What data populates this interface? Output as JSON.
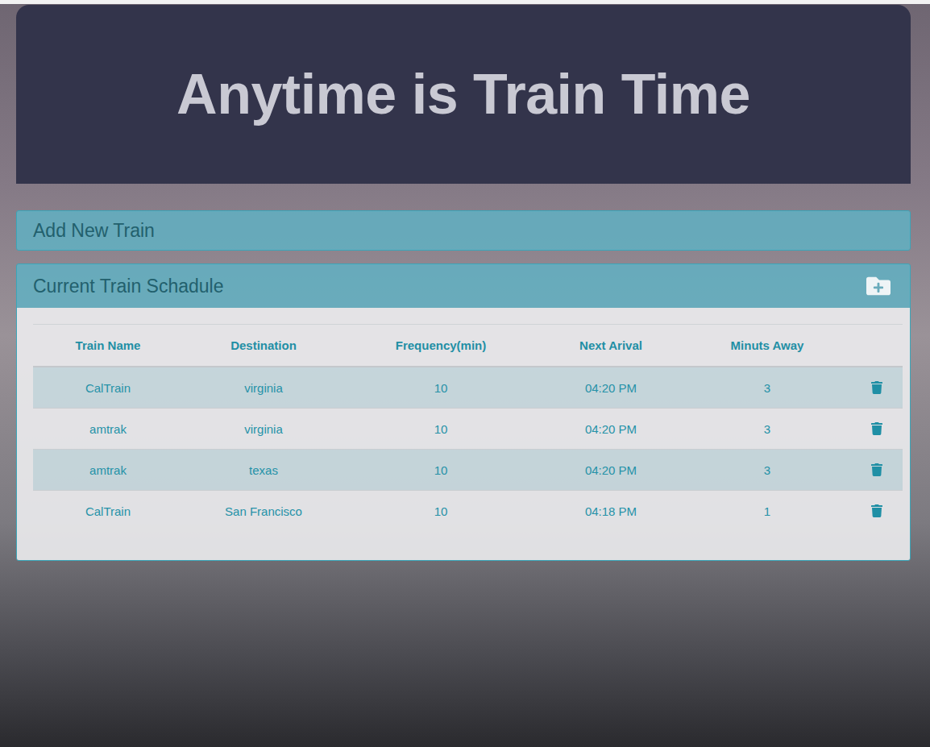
{
  "header": {
    "title": "Anytime is Train Time"
  },
  "add_panel": {
    "title": "Add New Train"
  },
  "schedule_panel": {
    "title": "Current Train Schadule"
  },
  "table": {
    "columns": [
      "Train Name",
      "Destination",
      "Frequency(min)",
      "Next Arival",
      "Minuts Away"
    ],
    "rows": [
      {
        "name": "CalTrain",
        "destination": "virginia",
        "frequency": "10",
        "next_arrival": "04:20 PM",
        "minutes_away": "3"
      },
      {
        "name": "amtrak",
        "destination": "virginia",
        "frequency": "10",
        "next_arrival": "04:20 PM",
        "minutes_away": "3"
      },
      {
        "name": "amtrak",
        "destination": "texas",
        "frequency": "10",
        "next_arrival": "04:20 PM",
        "minutes_away": "3"
      },
      {
        "name": "CalTrain",
        "destination": "San Francisco",
        "frequency": "10",
        "next_arrival": "04:18 PM",
        "minutes_away": "1"
      }
    ]
  }
}
